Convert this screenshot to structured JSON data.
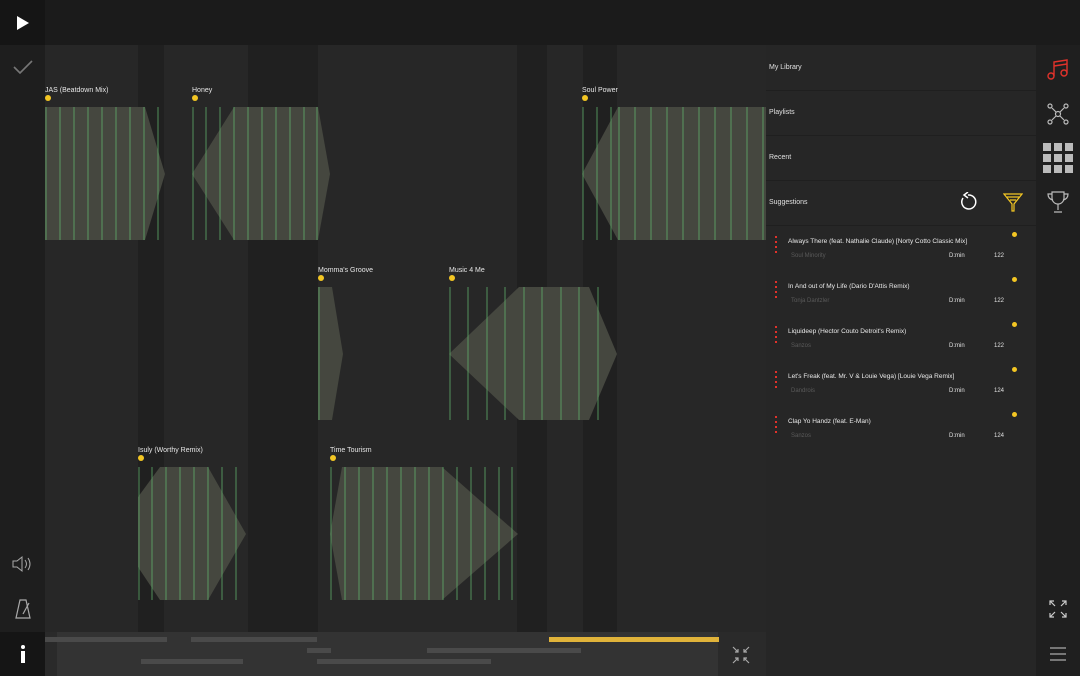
{
  "colors": {
    "accent": "#f3c623",
    "active_icon": "#e0322b",
    "clip_fill": "#45473f",
    "beat_line": "#5fae6a"
  },
  "toolbar": {
    "play_icon": "play-icon",
    "check_icon": "check-icon",
    "volume_icon": "speaker-icon",
    "metronome_icon": "metronome-icon",
    "info_icon": "info-icon"
  },
  "canvas": {
    "clips": [
      {
        "label": "JAS (Beatdown Mix)"
      },
      {
        "label": "Honey"
      },
      {
        "label": "Soul Power"
      },
      {
        "label": "Momma's Groove"
      },
      {
        "label": "Music 4 Me"
      },
      {
        "label": "Isuly (Worthy Remix)"
      },
      {
        "label": "Time Tourism"
      }
    ]
  },
  "library": {
    "nav": [
      "My Library",
      "Playlists",
      "Recent",
      "Suggestions"
    ],
    "tracks": [
      {
        "title": "Always There (feat. Nathalie Claude) [Norty Cotto Classic Mix]",
        "artist": "Soul Minority",
        "key": "D:min",
        "bpm": "122"
      },
      {
        "title": "In And out of My Life (Dario D'Attis Remix)",
        "artist": "Tonja Dantzler",
        "key": "D:min",
        "bpm": "122"
      },
      {
        "title": "Liquideep (Hector Couto Detroit's Remix)",
        "artist": "Sanzos",
        "key": "D:min",
        "bpm": "122"
      },
      {
        "title": "Let's Freak (feat. Mr. V & Louie Vega) [Louie Vega Remix]",
        "artist": "Dandrois",
        "key": "D:min",
        "bpm": "124"
      },
      {
        "title": "Clap Yo Handz (feat. E-Man)",
        "artist": "Sanzos",
        "key": "D:min",
        "bpm": "124"
      }
    ]
  },
  "sidebar_icons": [
    "music-note-icon",
    "network-icon",
    "grid-icon",
    "trophy-icon",
    "expand-icon",
    "menu-icon"
  ]
}
